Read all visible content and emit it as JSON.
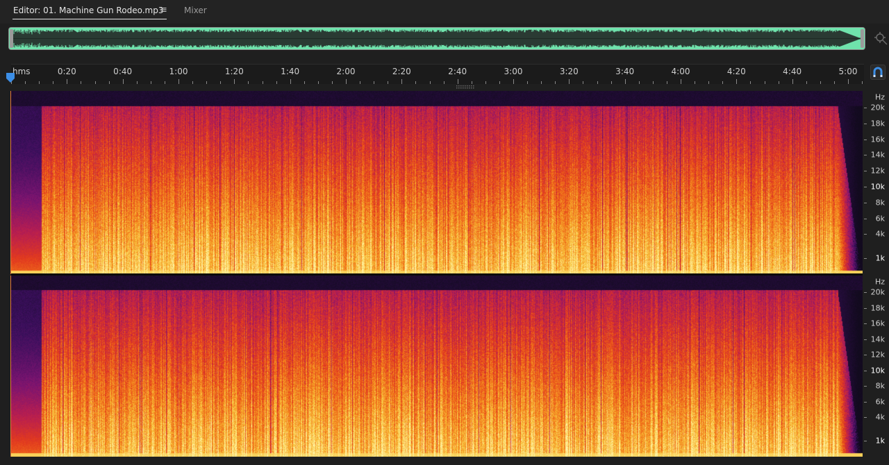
{
  "tabs": {
    "editor_label": "Editor: 01. Machine Gun Rodeo.mp3",
    "menu_glyph": "≡",
    "mixer_label": "Mixer"
  },
  "overview": {
    "waveform_color": "#6fe3ac",
    "icon": "zoom-navigator-icon"
  },
  "timeline": {
    "unit_label": "hms",
    "duration_seconds": 310,
    "labels": [
      "0:20",
      "0:40",
      "1:00",
      "1:20",
      "1:40",
      "2:00",
      "2:20",
      "2:40",
      "3:00",
      "3:20",
      "3:40",
      "4:00",
      "4:20",
      "4:40",
      "5:00"
    ],
    "snap_icon": "magnet-icon",
    "accent_color": "#3c8ee6"
  },
  "frequency_scale": {
    "unit": "Hz",
    "labels": [
      "20k",
      "18k",
      "16k",
      "14k",
      "12k",
      "10k",
      "8k",
      "6k",
      "4k",
      "1k"
    ],
    "bold_labels": [
      "10k",
      "1k"
    ]
  },
  "spectrogram": {
    "palette": [
      "#120a1e",
      "#3a0f5c",
      "#7a1470",
      "#b81e50",
      "#e23a1e",
      "#f27a1a",
      "#f8c23a",
      "#fff0a0"
    ]
  }
}
